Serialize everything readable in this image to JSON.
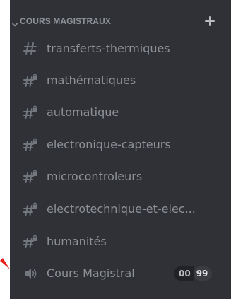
{
  "category": {
    "label": "COURS MAGISTRAUX",
    "chevron_icon": "chevron-down-icon",
    "add_icon": "plus-icon"
  },
  "text_channels": [
    {
      "name": "transferts-thermiques",
      "icon": "hash-icon",
      "locked": false
    },
    {
      "name": "mathématiques",
      "icon": "hash-lock-icon",
      "locked": true
    },
    {
      "name": "automatique",
      "icon": "hash-lock-icon",
      "locked": true
    },
    {
      "name": "electronique-capteurs",
      "icon": "hash-lock-icon",
      "locked": true
    },
    {
      "name": "microcontroleurs",
      "icon": "hash-lock-icon",
      "locked": true
    },
    {
      "name": "electrotechnique-et-elec...",
      "icon": "hash-lock-icon",
      "locked": true
    },
    {
      "name": "humanités",
      "icon": "hash-lock-icon",
      "locked": true
    }
  ],
  "voice_channel": {
    "name": "Cours Magistral",
    "icon": "speaker-icon",
    "user_count": "00",
    "user_limit": "99"
  },
  "annotation": {
    "icon": "red-arrow-icon"
  },
  "colors": {
    "background": "#2f3136",
    "text_muted": "#8e9297",
    "arrow": "#e8201c"
  }
}
